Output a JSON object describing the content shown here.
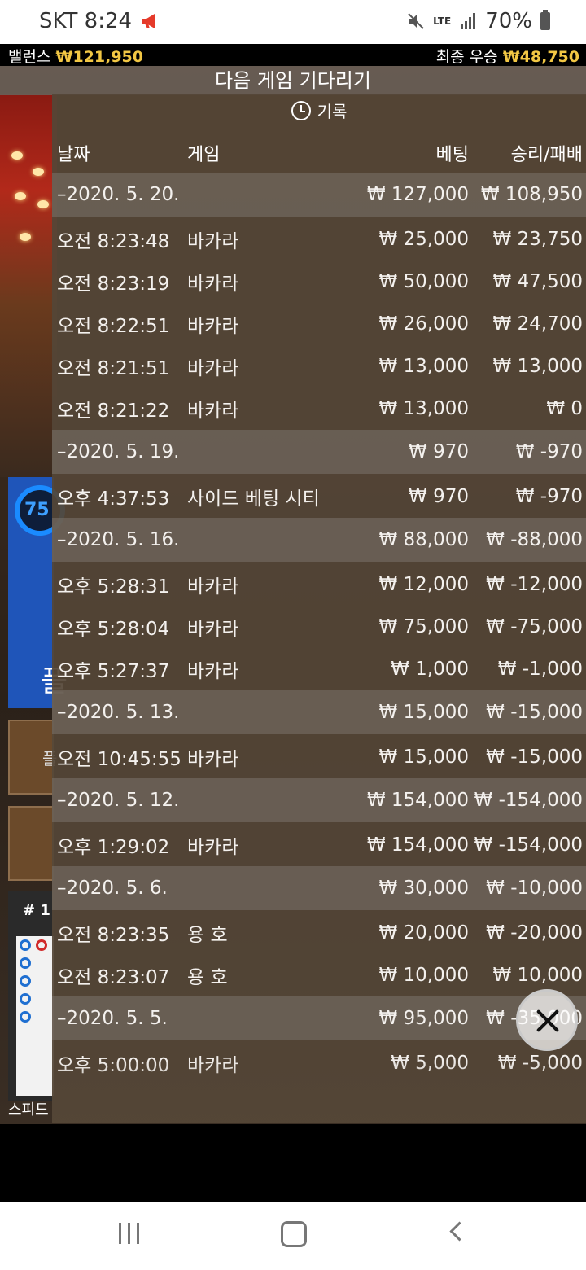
{
  "status_bar": {
    "carrier_time": "SKT 8:24",
    "network": "LTE",
    "battery": "70%"
  },
  "info_bar": {
    "balance_label": "밸런스",
    "balance_value": "₩121,950",
    "last_win_label": "최종 우승",
    "last_win_value": "₩48,750"
  },
  "overlay_title": "다음 게임 기다리기",
  "history": {
    "header": "기록",
    "columns": {
      "date": "날짜",
      "game": "게임",
      "bet": "베팅",
      "win_loss": "승리/패배"
    },
    "rows": [
      {
        "kind": "day",
        "date": "–2020. 5. 20.",
        "game": "",
        "bet": "₩ 127,000",
        "win": "₩ 108,950"
      },
      {
        "kind": "entry",
        "date": "오전 8:23:48",
        "game": "바카라",
        "bet": "₩ 25,000",
        "win": "₩ 23,750"
      },
      {
        "kind": "entry",
        "date": "오전 8:23:19",
        "game": "바카라",
        "bet": "₩ 50,000",
        "win": "₩ 47,500"
      },
      {
        "kind": "entry",
        "date": "오전 8:22:51",
        "game": "바카라",
        "bet": "₩ 26,000",
        "win": "₩ 24,700"
      },
      {
        "kind": "entry",
        "date": "오전 8:21:51",
        "game": "바카라",
        "bet": "₩ 13,000",
        "win": "₩ 13,000"
      },
      {
        "kind": "entry",
        "date": "오전 8:21:22",
        "game": "바카라",
        "bet": "₩ 13,000",
        "win": "₩ 0"
      },
      {
        "kind": "day",
        "date": "–2020. 5. 19.",
        "game": "",
        "bet": "₩ 970",
        "win": "₩ -970"
      },
      {
        "kind": "entry",
        "date": "오후 4:37:53",
        "game": "사이드 베팅 시티",
        "bet": "₩ 970",
        "win": "₩ -970"
      },
      {
        "kind": "day",
        "date": "–2020. 5. 16.",
        "game": "",
        "bet": "₩ 88,000",
        "win": "₩ -88,000"
      },
      {
        "kind": "entry",
        "date": "오후 5:28:31",
        "game": "바카라",
        "bet": "₩ 12,000",
        "win": "₩ -12,000"
      },
      {
        "kind": "entry",
        "date": "오후 5:28:04",
        "game": "바카라",
        "bet": "₩ 75,000",
        "win": "₩ -75,000"
      },
      {
        "kind": "entry",
        "date": "오후 5:27:37",
        "game": "바카라",
        "bet": "₩ 1,000",
        "win": "₩ -1,000"
      },
      {
        "kind": "day",
        "date": "–2020. 5. 13.",
        "game": "",
        "bet": "₩ 15,000",
        "win": "₩ -15,000"
      },
      {
        "kind": "entry",
        "date": "오전 10:45:55",
        "game": "바카라",
        "bet": "₩ 15,000",
        "win": "₩ -15,000"
      },
      {
        "kind": "day",
        "date": "–2020. 5. 12.",
        "game": "",
        "bet": "₩ 154,000",
        "win": "₩ -154,000"
      },
      {
        "kind": "entry",
        "date": "오후 1:29:02",
        "game": "바카라",
        "bet": "₩ 154,000",
        "win": "₩ -154,000"
      },
      {
        "kind": "day",
        "date": "–2020. 5. 6.",
        "game": "",
        "bet": "₩ 30,000",
        "win": "₩ -10,000"
      },
      {
        "kind": "entry",
        "date": "오전 8:23:35",
        "game": "용 호",
        "bet": "₩ 20,000",
        "win": "₩ -20,000"
      },
      {
        "kind": "entry",
        "date": "오전 8:23:07",
        "game": "용 호",
        "bet": "₩ 10,000",
        "win": "₩ 10,000"
      },
      {
        "kind": "day",
        "date": "–2020. 5. 5.",
        "game": "",
        "bet": "₩ 95,000",
        "win": "₩ -35,000"
      },
      {
        "kind": "entry",
        "date": "오후 5:00:00",
        "game": "바카라",
        "bet": "₩ 5,000",
        "win": "₩ -5,000"
      }
    ]
  },
  "background": {
    "timer_value": "75",
    "panel_text": "플",
    "roadmap_header": "# 1",
    "bottom_label": "스피드"
  },
  "colors": {
    "gold": "#f2c744",
    "panel_blue": "#1f55b9"
  },
  "icons": {
    "history": "clock-history-icon",
    "close": "close-icon",
    "notify": "megaphone-icon"
  }
}
